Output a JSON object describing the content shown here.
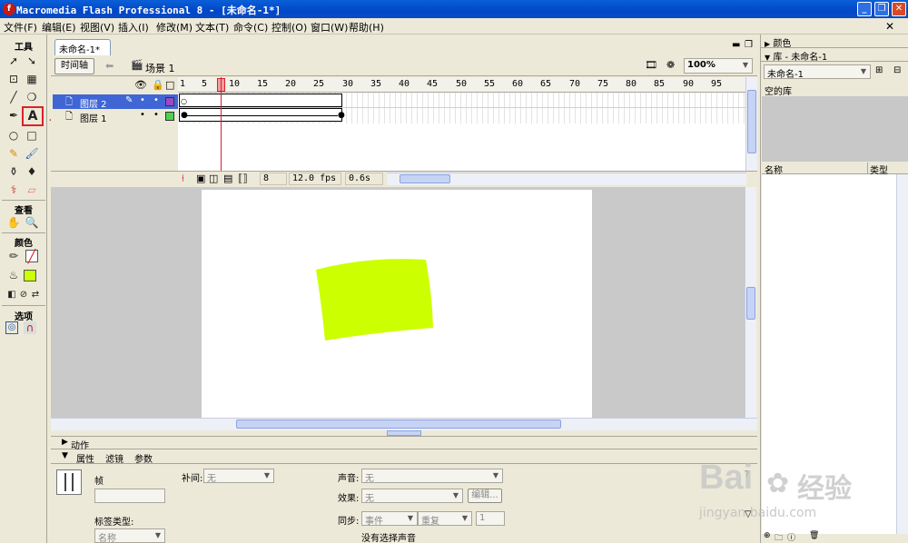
{
  "window": {
    "title": "Macromedia Flash Professional 8 - [未命名-1*]",
    "app_icon": "flash-logo-icon",
    "minimize_symbol": "_",
    "restore_symbol": "❐",
    "close_symbol": "✕"
  },
  "menu": {
    "file": "文件(F)",
    "edit": "编辑(E)",
    "view": "视图(V)",
    "insert": "插入(I)",
    "modify": "修改(M)",
    "text": "文本(T)",
    "commands": "命令(C)",
    "control": "控制(O)",
    "window": "窗口(W)",
    "help": "帮助(H)"
  },
  "toolbox": {
    "tools_header": "工具",
    "view_header": "查看",
    "colors_header": "颜色",
    "options_header": "选项",
    "text_tool_glyph": "A",
    "highlight_color": "#d8232a"
  },
  "document": {
    "tab_label": "未命名-1*",
    "timeline_button": "时间轴",
    "scene_label": "场景 1",
    "zoom": "100%"
  },
  "timeline": {
    "layers": [
      {
        "name": "图层 2",
        "color": "#9a49c7",
        "selected": true
      },
      {
        "name": "图层 1",
        "color": "#4ed24e",
        "selected": false
      }
    ],
    "ruler_ticks": [
      "1",
      "5",
      "10",
      "15",
      "20",
      "25",
      "30",
      "35",
      "40",
      "45",
      "50",
      "55",
      "60",
      "65",
      "70",
      "75",
      "80",
      "85",
      "90",
      "95"
    ],
    "current_frame": "8",
    "fps": "12.0 fps",
    "elapsed": "0.6s"
  },
  "stage": {
    "shape_color": "#ccff00"
  },
  "panels": {
    "actions_label": "动作",
    "tab_properties": "属性",
    "tab_filters": "滤镜",
    "tab_params": "参数"
  },
  "properties": {
    "frame_label": "帧",
    "tween_label": "补间:",
    "tween_value": "无",
    "sound_label": "声音:",
    "sound_value": "无",
    "effect_label": "效果:",
    "effect_value": "无",
    "edit_button": "编辑...",
    "sync_label": "同步:",
    "sync_value": "事件",
    "repeat_value": "重复",
    "repeat_count": "1",
    "no_sound": "没有选择声音",
    "label_type": "标签类型:",
    "name_value": "名称"
  },
  "right_panel": {
    "color_header": "颜色",
    "library_header": "库 - 未命名-1",
    "library_select": "未命名-1",
    "empty_library": "空的库",
    "col_name": "名称",
    "col_type": "类型"
  },
  "watermark": {
    "brand": "Bai",
    "brand_cn": "经验",
    "url": "jingyan.baidu.com"
  }
}
